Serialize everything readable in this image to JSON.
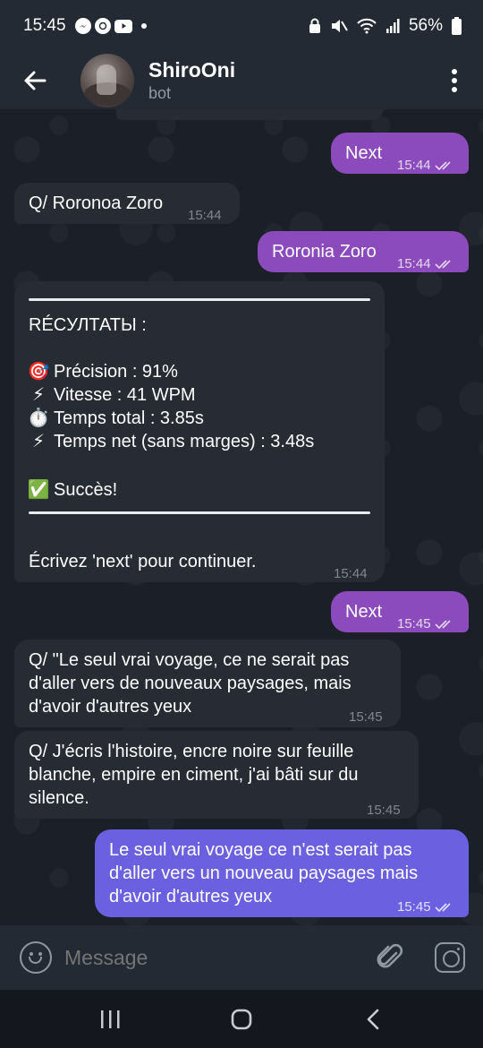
{
  "status_bar": {
    "time": "15:45",
    "battery": "56%"
  },
  "header": {
    "back_icon": "arrow-left-icon",
    "title": "ShiroOni",
    "subtitle": "bot",
    "menu_icon": "more-vertical-icon"
  },
  "messages": [
    {
      "id": "m1",
      "dir": "out",
      "text": "Next",
      "time": "15:44"
    },
    {
      "id": "m2",
      "dir": "in",
      "text": "Q/ Roronoa Zoro",
      "time": "15:44"
    },
    {
      "id": "m3",
      "dir": "out",
      "text": "Roronia Zoro",
      "time": "15:44"
    },
    {
      "id": "m4",
      "dir": "in",
      "time": "15:44",
      "heading": "RÉCУЛТАТЫ :",
      "lines": [
        {
          "icon": "🎯",
          "text": "Précision : 91%"
        },
        {
          "icon": "⚡",
          "text": "Vitesse : 41 WPM"
        },
        {
          "icon": "⏱️",
          "text": "Temps total : 3.85s"
        },
        {
          "icon": "⚡",
          "text": "Temps net (sans marges) : 3.48s"
        }
      ],
      "result_icon": "✅",
      "result": "Succès!",
      "footer": "Écrivez 'next' pour continuer."
    },
    {
      "id": "m5",
      "dir": "out",
      "text": "Next",
      "time": "15:45"
    },
    {
      "id": "m6",
      "dir": "in",
      "time": "15:45",
      "lines": [
        "Q/ \"Le seul vrai voyage, ce ne serait pas",
        "d'aller vers de nouveaux paysages, mais",
        "d'avoir d'autres yeux"
      ]
    },
    {
      "id": "m7",
      "dir": "in",
      "time": "15:45",
      "lines": [
        "Q/ J'écris l'histoire, encre noire sur feuille",
        "blanche,  empire en ciment, j'ai bâti sur du",
        "silence."
      ]
    },
    {
      "id": "m8",
      "dir": "out",
      "time": "15:45",
      "lines": [
        "Le seul vrai voyage ce n'est serait pas",
        "d'aller vers un nouveau paysages mais",
        "d'avoir d'autres yeux"
      ]
    }
  ],
  "composer": {
    "placeholder": "Message",
    "emoji_icon": "emoji-icon",
    "attach_icon": "paperclip-icon",
    "camera_icon": "camera-icon"
  },
  "colors": {
    "bg": "#1b2028",
    "incoming": "#272b33",
    "outgoing": "#8b4bbd",
    "outgoing_last": "#6b61e0",
    "header": "#232a33"
  }
}
